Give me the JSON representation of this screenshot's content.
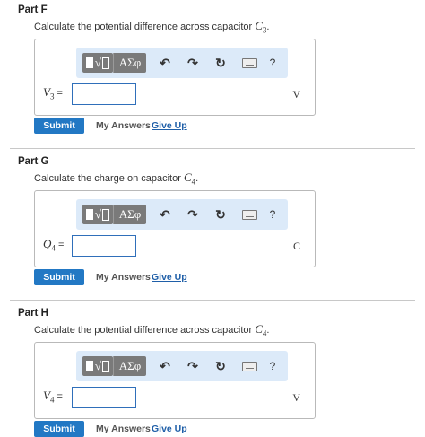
{
  "toolbar": {
    "templates_label": "√",
    "greek_label": "ΑΣφ",
    "undo_icon": "undo-icon",
    "redo_icon": "redo-icon",
    "reset_icon": "reset-icon",
    "keyboard_icon": "keyboard-icon",
    "help_label": "?"
  },
  "buttons": {
    "submit": "Submit",
    "my_answers": "My Answers",
    "give_up": "Give Up"
  },
  "parts": [
    {
      "title": "Part F",
      "question_prefix": "Calculate the potential difference across capacitor ",
      "question_var": "C",
      "question_sub": "3",
      "question_suffix": ".",
      "var_main": "V",
      "var_sub": "3",
      "eq": " =",
      "input_value": "",
      "unit": "V"
    },
    {
      "title": "Part G",
      "question_prefix": "Calculate the charge on capacitor ",
      "question_var": "C",
      "question_sub": "4",
      "question_suffix": ".",
      "var_main": "Q",
      "var_sub": "4",
      "eq": " =",
      "input_value": "",
      "unit": "C"
    },
    {
      "title": "Part H",
      "question_prefix": "Calculate the potential difference across capacitor ",
      "question_var": "C",
      "question_sub": "4",
      "question_suffix": ".",
      "var_main": "V",
      "var_sub": "4",
      "eq": " =",
      "input_value": "",
      "unit": "V"
    }
  ],
  "colors": {
    "accent": "#2278c4",
    "toolbar_bg": "#dceaf9",
    "link": "#1f5fa8"
  }
}
